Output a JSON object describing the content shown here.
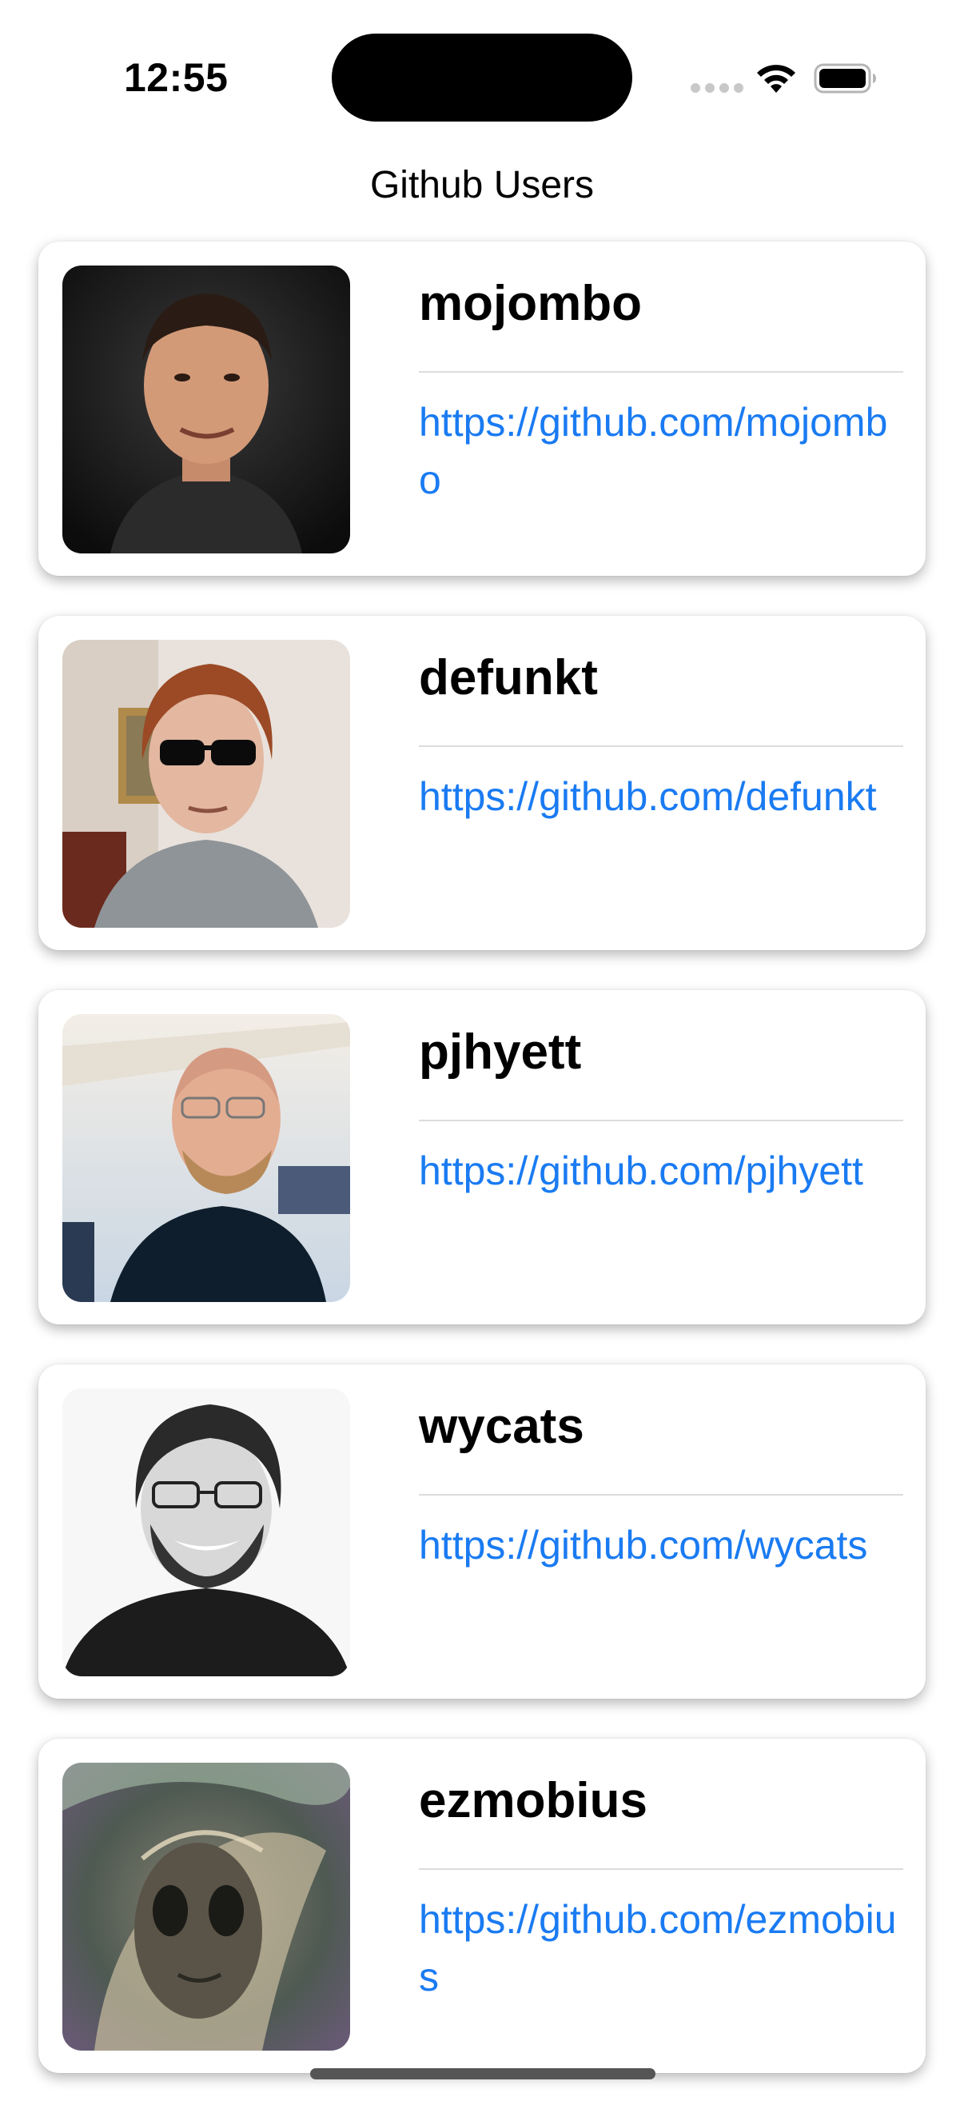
{
  "status_bar": {
    "time": "12:55",
    "icons": [
      "cellular-signal-icon",
      "wifi-icon",
      "battery-icon"
    ]
  },
  "nav": {
    "title": "Github Users"
  },
  "colors": {
    "link": "#1a7bf2",
    "divider": "#dcdcdc",
    "background": "#ffffff"
  },
  "users": [
    {
      "username": "mojombo",
      "url": "https://github.com/mojombo"
    },
    {
      "username": "defunkt",
      "url": "https://github.com/defunkt"
    },
    {
      "username": "pjhyett",
      "url": "https://github.com/pjhyett"
    },
    {
      "username": "wycats",
      "url": "https://github.com/wycats"
    },
    {
      "username": "ezmobius",
      "url": "https://github.com/ezmobius"
    }
  ]
}
